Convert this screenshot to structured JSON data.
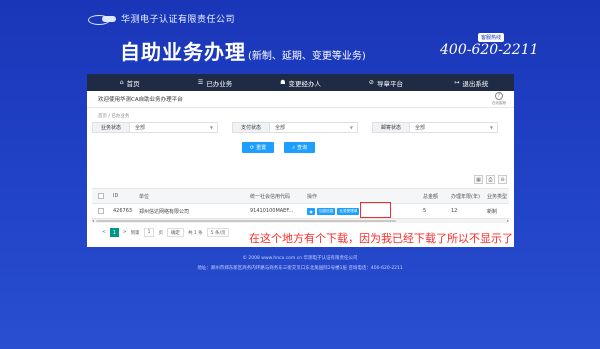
{
  "header": {
    "company": "华测电子认证有限责任公司",
    "title_main": "自助业务办理",
    "title_sub": "(新制、延期、变更等业务)",
    "hotline_badge": "客服热线",
    "hotline_number": "400-620-2211"
  },
  "nav": {
    "items": [
      {
        "icon": "⌂",
        "label": "首页"
      },
      {
        "icon": "☰",
        "label": "已办业务"
      },
      {
        "icon": "☗",
        "label": "变更经办人"
      },
      {
        "icon": "⊘",
        "label": "导章平台"
      },
      {
        "icon": "↦",
        "label": "退出系统"
      }
    ]
  },
  "welcome": {
    "text": "欢迎使用华测CA自助业务办理平台",
    "help_label": "在线客服"
  },
  "breadcrumb": "首页 / 已办业务",
  "filters": [
    {
      "label": "业务状态",
      "value": "全部"
    },
    {
      "label": "支付状态",
      "value": "全部"
    },
    {
      "label": "邮寄状态",
      "value": "全部"
    }
  ],
  "buttons": {
    "reset": "重置",
    "query": "查询"
  },
  "toolbar_icons": [
    "▦",
    "⎙",
    "⊖"
  ],
  "table": {
    "headers": [
      "ID",
      "单位",
      "统一社会信用代码",
      "操作",
      "",
      "总金额",
      "办理年限(年)",
      "业务类型"
    ],
    "rows": [
      {
        "id": "426763",
        "unit": "郑州信达网络有限公司",
        "credit_code": "91410100MAEF...",
        "op_detail": "加密信息",
        "op_pay": "业务受理单",
        "amount": "5",
        "years": "12",
        "type": "新制"
      }
    ]
  },
  "pager": {
    "prev": "<",
    "page": "1",
    "next": ">",
    "goto_label": "到第",
    "goto_value": "1",
    "page_unit": "页",
    "confirm": "确定",
    "total": "共 1 条",
    "per_page": "5 条/页"
  },
  "annotation": "在这个地方有个下载，因为我已经下载了所以不显示了",
  "footer": {
    "copyright": "© 2008 www.hnca.com.cn 华测电子认证有限责任公司",
    "address": "地址：郑州市郑东新区商务内环路与商务东三街交叉口东北角国际2号楼1层 咨询电话：400-620-2211"
  }
}
